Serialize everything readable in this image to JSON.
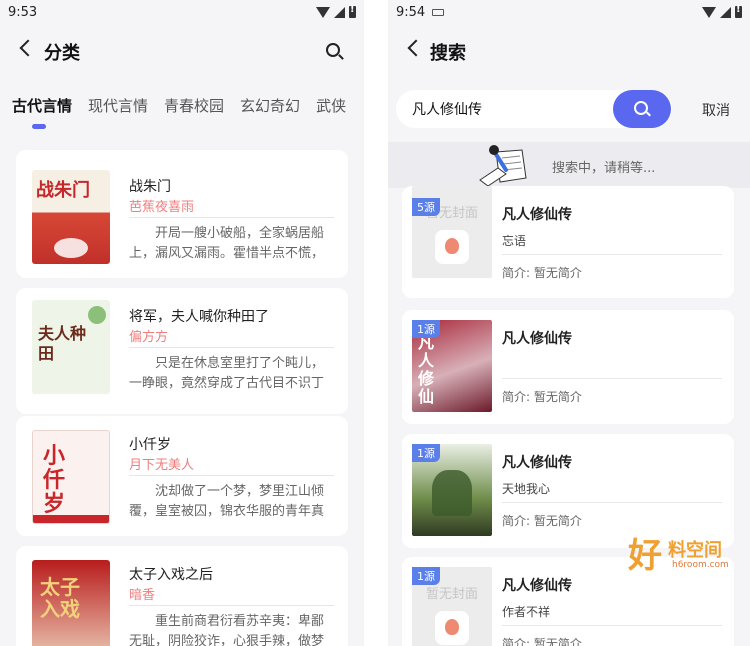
{
  "left": {
    "status_time": "9:53",
    "title": "分类",
    "tabs": [
      "古代言情",
      "现代言情",
      "青春校园",
      "玄幻奇幻",
      "武侠"
    ],
    "books": [
      {
        "title": "战朱门",
        "author": "芭蕉夜喜雨",
        "desc": "开局一艘小破船，全家蜗居船上，漏风又漏雨。霍惜半点不慌，卯...",
        "cover_text": "战朱门"
      },
      {
        "title": "将军，夫人喊你种田了",
        "author": "偏方方",
        "desc": "只是在休息室里打了个盹儿，一睁眼，竟然穿成了古代目不识丁的乡...",
        "cover_text": "夫人种田"
      },
      {
        "title": "小仟岁",
        "author": "月下无美人",
        "desc": "沈却做了一个梦，梦里江山倾覆，皇室被囚，锦衣华服的青年真坐...",
        "cover_text": "小仟岁"
      },
      {
        "title": "太子入戏之后",
        "author": "暗香",
        "desc": "重生前商君衍看苏辛夷：卑鄙无耻，阴险狡诈，心狠手辣，做梦都想...",
        "cover_text": "太子入戏"
      }
    ]
  },
  "right": {
    "status_time": "9:54",
    "title": "搜索",
    "query": "凡人修仙传",
    "cancel": "取消",
    "searching": "搜索中，请稍等...",
    "results": [
      {
        "badge": "5源",
        "title": "凡人修仙传",
        "sub": "忘语",
        "intro": "简介: 暂无简介",
        "placeholder": "暂无封面"
      },
      {
        "badge": "1源",
        "title": "凡人修仙传",
        "sub": "",
        "intro": "简介: 暂无简介",
        "placeholder": ""
      },
      {
        "badge": "1源",
        "title": "凡人修仙传",
        "sub": "天地我心",
        "intro": "简介: 暂无简介",
        "placeholder": ""
      },
      {
        "badge": "1源",
        "title": "凡人修仙传",
        "sub": "作者不祥",
        "intro": "简介: 暂无简介",
        "placeholder": "暂无封面"
      }
    ]
  },
  "watermark": {
    "big": "好",
    "mid": "料空间",
    "small": "h6room.com"
  },
  "colors": {
    "accent": "#5a68f0",
    "author": "#f07e7e",
    "badge": "#5a7fe8"
  }
}
